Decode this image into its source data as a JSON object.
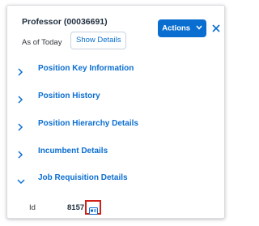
{
  "header": {
    "title": "Professor (00036691)",
    "as_of": "As of Today",
    "show_details_label": "Show Details",
    "actions_label": "Actions"
  },
  "sections": [
    {
      "label": "Position Key Information",
      "expanded": false
    },
    {
      "label": "Position History",
      "expanded": false
    },
    {
      "label": "Position Hierarchy Details",
      "expanded": false
    },
    {
      "label": "Incumbent Details",
      "expanded": false
    },
    {
      "label": "Job Requisition Details",
      "expanded": true
    }
  ],
  "job_requisition": {
    "id_label": "Id",
    "id_value": "8157"
  },
  "colors": {
    "accent": "#0a6ed1",
    "highlight": "#d0201a"
  },
  "icons": {
    "actions": "chevron-down-icon",
    "close": "close-icon",
    "collapsed": "chevron-right-icon",
    "expanded": "chevron-down-icon",
    "id_link": "id-card-icon"
  }
}
